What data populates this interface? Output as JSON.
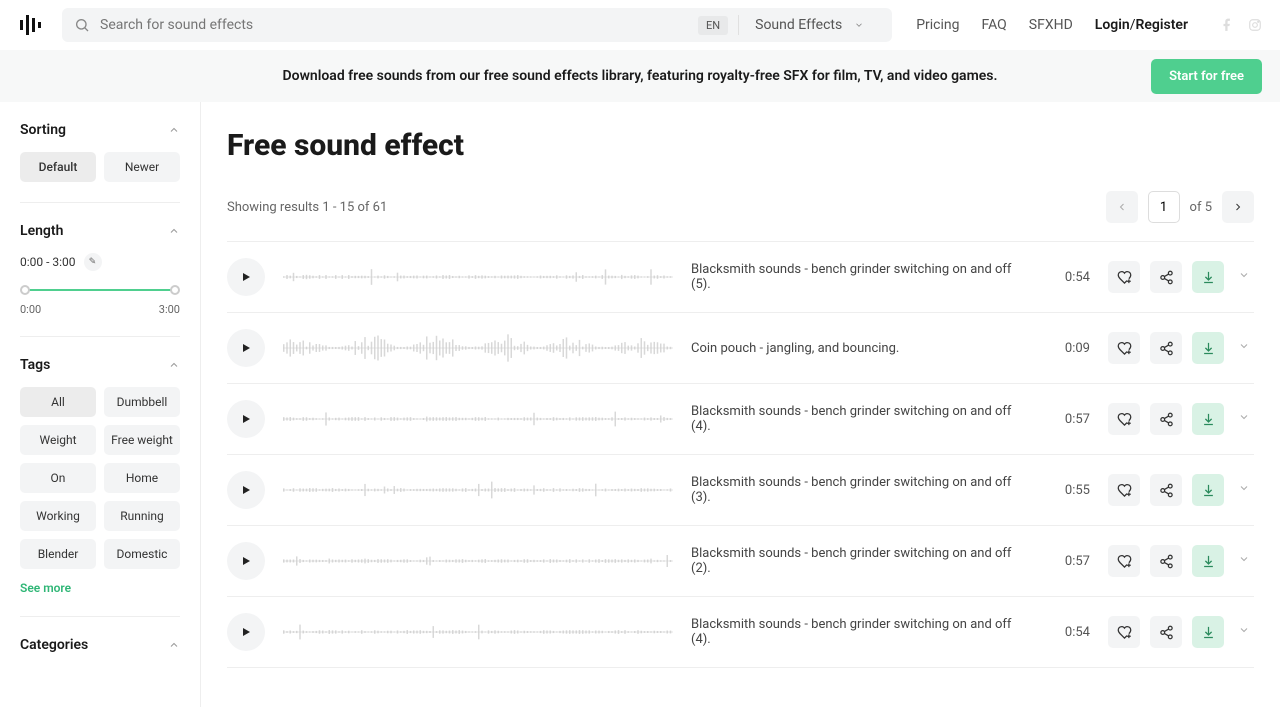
{
  "header": {
    "search_placeholder": "Search for sound effects",
    "lang": "EN",
    "dropdown": "Sound Effects",
    "nav": {
      "pricing": "Pricing",
      "faq": "FAQ",
      "sfxhd": "SFXHD",
      "login": "Login",
      "register": "Register"
    }
  },
  "banner": {
    "text": "Download free sounds from our free sound effects library, featuring royalty-free SFX for film, TV, and video games.",
    "cta": "Start for free"
  },
  "sidebar": {
    "sorting": {
      "title": "Sorting",
      "default": "Default",
      "newer": "Newer"
    },
    "length": {
      "title": "Length",
      "range": "0:00 - 3:00",
      "min": "0:00",
      "max": "3:00"
    },
    "tags": {
      "title": "Tags",
      "items": [
        "All",
        "Dumbbell",
        "Weight",
        "Free weight",
        "On",
        "Home",
        "Working",
        "Running",
        "Blender",
        "Domestic"
      ],
      "see_more": "See more"
    },
    "categories": {
      "title": "Categories"
    }
  },
  "page": {
    "title": "Free sound effect",
    "results_text": "Showing results 1 - 15 of 61",
    "page_input": "1",
    "page_of": "of 5"
  },
  "rows": [
    {
      "title": "Blacksmith sounds - bench grinder switching on and off (5).",
      "dur": "0:54"
    },
    {
      "title": "Coin pouch - jangling, and bouncing.",
      "dur": "0:09"
    },
    {
      "title": "Blacksmith sounds - bench grinder switching on and off (4).",
      "dur": "0:57"
    },
    {
      "title": "Blacksmith sounds - bench grinder switching on and off (3).",
      "dur": "0:55"
    },
    {
      "title": "Blacksmith sounds - bench grinder switching on and off (2).",
      "dur": "0:57"
    },
    {
      "title": "Blacksmith sounds - bench grinder switching on and off (4).",
      "dur": "0:54"
    }
  ]
}
